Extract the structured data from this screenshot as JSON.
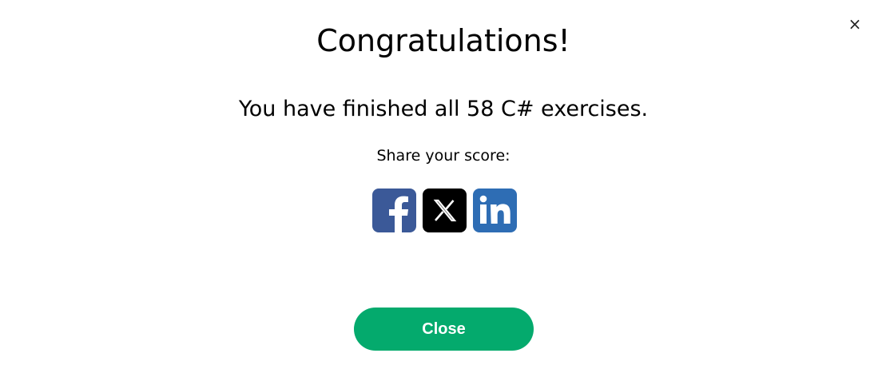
{
  "dialog": {
    "close_icon": "close-icon",
    "close_glyph": "×",
    "title": "Congratulations!",
    "message": "You have finished all 58 C# exercises.",
    "share_label": "Share your score:",
    "share_buttons": [
      {
        "name": "facebook",
        "icon": "facebook-icon",
        "color": "#3b5998"
      },
      {
        "name": "x",
        "icon": "x-icon",
        "color": "#000000"
      },
      {
        "name": "linkedin",
        "icon": "linkedin-icon",
        "color": "#2e6db4"
      }
    ],
    "close_button_label": "Close",
    "close_button_color": "#04aa6d"
  }
}
